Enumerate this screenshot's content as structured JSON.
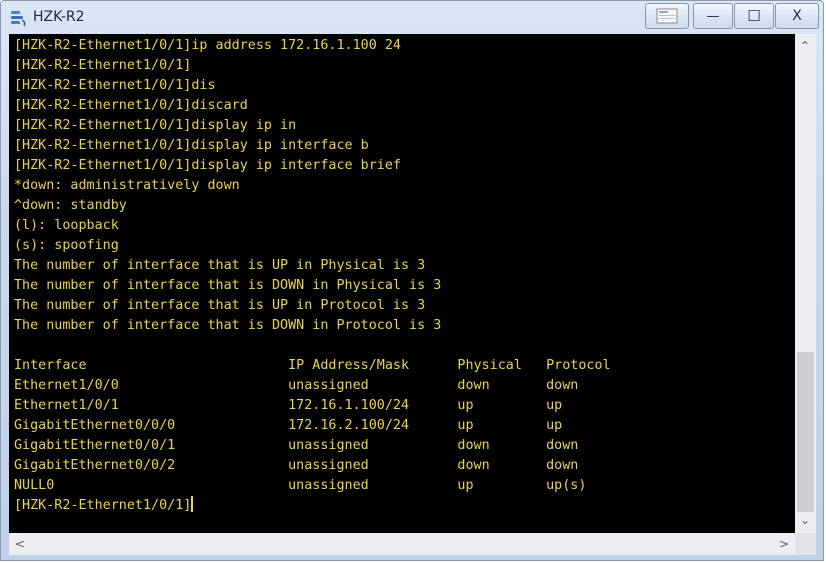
{
  "window": {
    "title": "HZK-R2",
    "app_icon": "terminal-app-icon",
    "buttons": {
      "restore_icon": "restore-session-icon",
      "minimize": "—",
      "maximize": "☐",
      "close": "X"
    }
  },
  "terminal": {
    "lines": [
      "[HZK-R2-Ethernet1/0/1]ip address 172.16.1.100 24",
      "[HZK-R2-Ethernet1/0/1]",
      "[HZK-R2-Ethernet1/0/1]dis",
      "[HZK-R2-Ethernet1/0/1]discard",
      "[HZK-R2-Ethernet1/0/1]display ip in",
      "[HZK-R2-Ethernet1/0/1]display ip interface b",
      "[HZK-R2-Ethernet1/0/1]display ip interface brief",
      "*down: administratively down",
      "^down: standby",
      "(l): loopback",
      "(s): spoofing",
      "The number of interface that is UP in Physical is 3",
      "The number of interface that is DOWN in Physical is 3",
      "The number of interface that is UP in Protocol is 3",
      "The number of interface that is DOWN in Protocol is 3",
      "",
      "Interface                         IP Address/Mask      Physical   Protocol",
      "Ethernet1/0/0                     unassigned           down       down",
      "Ethernet1/0/1                     172.16.1.100/24      up         up",
      "GigabitEthernet0/0/0              172.16.2.100/24      up         up",
      "GigabitEthernet0/0/1              unassigned           down       down",
      "GigabitEthernet0/0/2              unassigned           down       down",
      "NULL0                             unassigned           up         up(s)"
    ],
    "prompt": "[HZK-R2-Ethernet1/0/1]",
    "text_color": "#e8d44d",
    "background": "#000000"
  },
  "scrollbars": {
    "up": "⌃",
    "down": "⌄",
    "left": "<",
    "right": ">"
  }
}
